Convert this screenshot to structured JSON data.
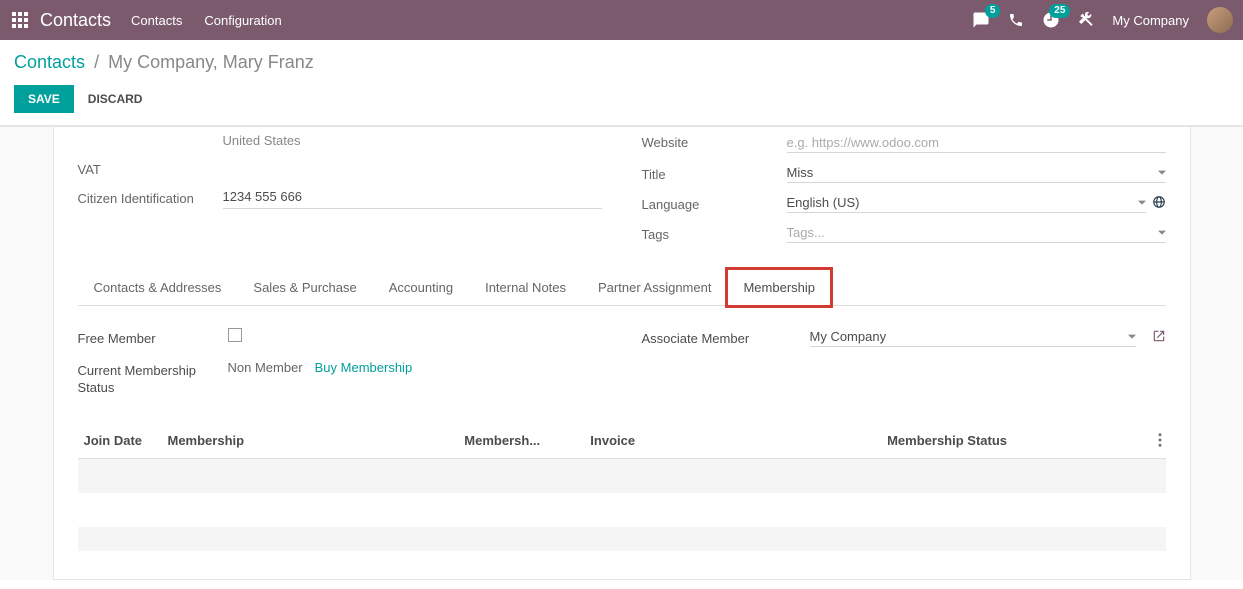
{
  "navbar": {
    "app_title": "Contacts",
    "links": [
      "Contacts",
      "Configuration"
    ],
    "chat_badge": "5",
    "clock_badge": "25",
    "company": "My Company"
  },
  "breadcrumb": {
    "root": "Contacts",
    "current": "My Company, Mary Franz"
  },
  "actions": {
    "save": "SAVE",
    "discard": "DISCARD"
  },
  "left_fields": {
    "country_value": "United States",
    "vat_label": "VAT",
    "citizen_id_label": "Citizen Identification",
    "citizen_id_value": "1234 555 666"
  },
  "right_fields": {
    "website_label": "Website",
    "website_placeholder": "e.g. https://www.odoo.com",
    "title_label": "Title",
    "title_value": "Miss",
    "language_label": "Language",
    "language_value": "English (US)",
    "tags_label": "Tags",
    "tags_placeholder": "Tags..."
  },
  "tabs": [
    "Contacts & Addresses",
    "Sales & Purchase",
    "Accounting",
    "Internal Notes",
    "Partner Assignment",
    "Membership"
  ],
  "active_tab_index": 5,
  "membership": {
    "free_member_label": "Free Member",
    "free_member_checked": false,
    "current_status_label": "Current Membership Status",
    "current_status_value": "Non Member",
    "buy_label": "Buy Membership",
    "associate_label": "Associate Member",
    "associate_value": "My Company"
  },
  "table": {
    "headers": [
      "Join Date",
      "Membership",
      "Membersh...",
      "Invoice",
      "Membership Status"
    ]
  }
}
